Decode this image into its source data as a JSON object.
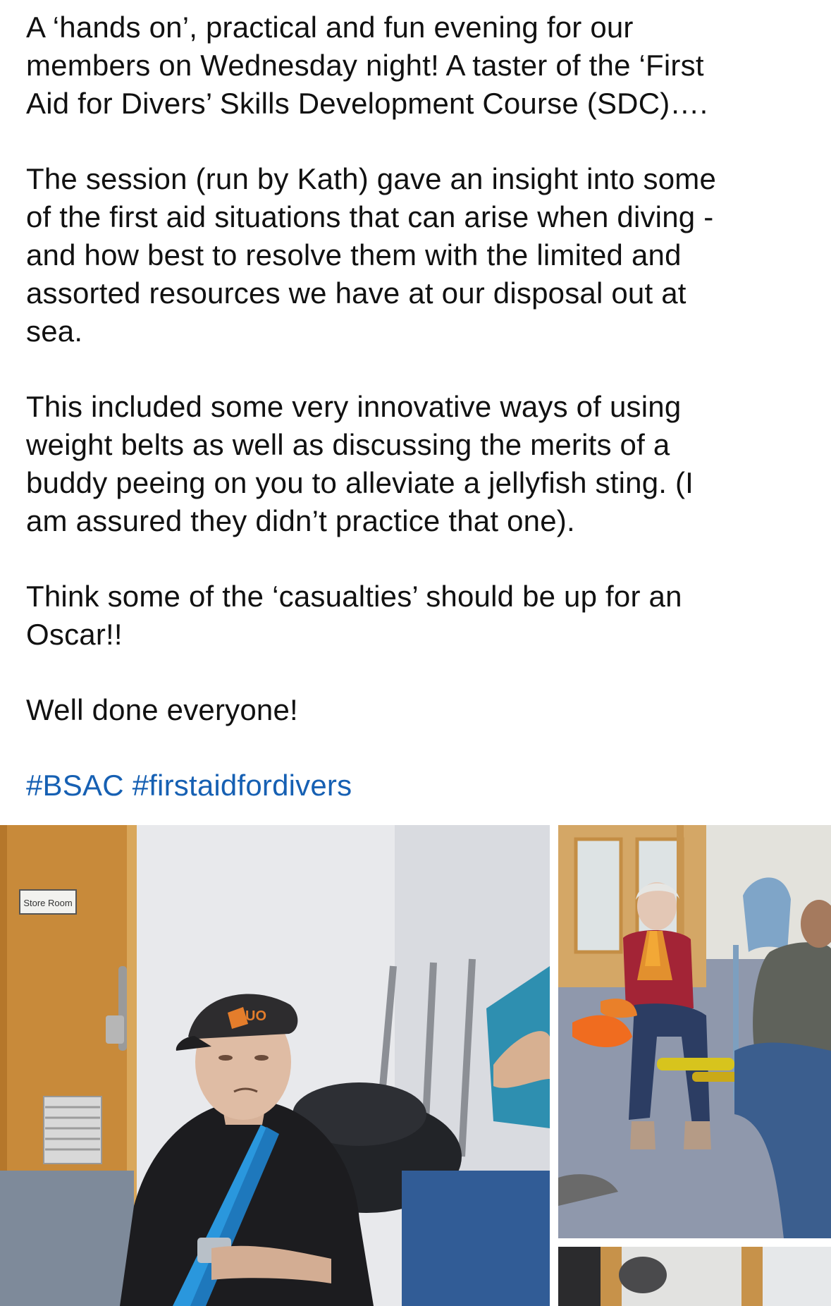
{
  "post": {
    "paragraphs": [
      "A ‘hands on’, practical and fun evening for our\nmembers on Wednesday night! A taster of the ‘First\nAid for Divers’ Skills Development Course (SDC)….",
      "The session (run by Kath) gave an insight into some\nof the first aid situations that can arise when diving -\nand how best to resolve them with the limited and\nassorted resources we have at our disposal out at\nsea.",
      "This included some very innovative ways of using\nweight belts as well as discussing the merits of a\nbuddy peeing on you to alleviate a jellyfish sting. (I\nam assured they didn’t practice that one).",
      "Think some of the ‘casualties’ should be up for an\nOscar!!",
      "Well done everyone!"
    ],
    "hashtags": [
      "#BSAC",
      "#firstaidfordivers"
    ]
  },
  "gallery": {
    "main_photo": {
      "door_sign": "Store Room",
      "cap_text": "UO"
    }
  },
  "colors": {
    "hashtag": "#1660b3",
    "text": "#111111",
    "belt_blue": "#1f95e0",
    "belt_orange": "#f06c1f",
    "belt_yellow": "#d7c41d"
  }
}
